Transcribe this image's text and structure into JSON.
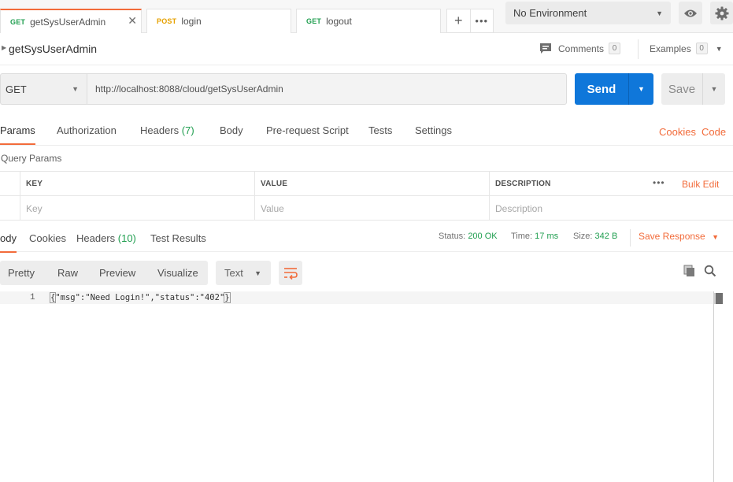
{
  "tabs": [
    {
      "method": "GET",
      "name": "getSysUserAdmin",
      "active": true
    },
    {
      "method": "POST",
      "name": "login"
    },
    {
      "method": "GET",
      "name": "logout"
    }
  ],
  "tab_close_glyph": "✕",
  "tab_actions": {
    "new": "+",
    "more": "•••"
  },
  "environment": {
    "selected": "No Environment"
  },
  "request": {
    "name": "getSysUserAdmin",
    "comments_label": "Comments",
    "comments_count": "0",
    "examples_label": "Examples",
    "examples_count": "0",
    "method": "GET",
    "url": "http://localhost:8088/cloud/getSysUserAdmin",
    "send_label": "Send",
    "save_label": "Save"
  },
  "request_tabs": [
    {
      "label": "Params",
      "active": true
    },
    {
      "label": "Authorization"
    },
    {
      "label": "Headers",
      "count": "(7)"
    },
    {
      "label": "Body"
    },
    {
      "label": "Pre-request Script"
    },
    {
      "label": "Tests"
    },
    {
      "label": "Settings"
    }
  ],
  "request_links": {
    "cookies": "Cookies",
    "code": "Code"
  },
  "query_params": {
    "title": "Query Params",
    "columns": [
      "KEY",
      "VALUE",
      "DESCRIPTION"
    ],
    "more": "•••",
    "bulk_edit": "Bulk Edit",
    "placeholders": {
      "key": "Key",
      "value": "Value",
      "description": "Description"
    }
  },
  "response_tabs": [
    {
      "label": "ody",
      "active": true
    },
    {
      "label": "Cookies"
    },
    {
      "label": "Headers",
      "count": "(10)"
    },
    {
      "label": "Test Results"
    }
  ],
  "response_status": {
    "status_label": "Status:",
    "status_value": "200 OK",
    "time_label": "Time:",
    "time_value": "17 ms",
    "size_label": "Size:",
    "size_value": "342 B",
    "save_response": "Save Response"
  },
  "view_modes": [
    "Pretty",
    "Raw",
    "Preview",
    "Visualize"
  ],
  "format": "Text",
  "response_body": {
    "line_number": "1",
    "open_brace": "{",
    "content": "\"msg\":\"Need Login!\",\"status\":\"402\"",
    "close_brace": "}"
  },
  "colors": {
    "accent": "#f26b3a",
    "send": "#0f77da",
    "success": "#1f9e4f",
    "post": "#e6a100"
  },
  "icons": [
    "close-icon",
    "plus-icon",
    "more-icon",
    "eye-icon",
    "gear-icon",
    "comment-icon",
    "caret-down-icon",
    "wrap-lines-icon",
    "copy-icon",
    "search-icon"
  ]
}
